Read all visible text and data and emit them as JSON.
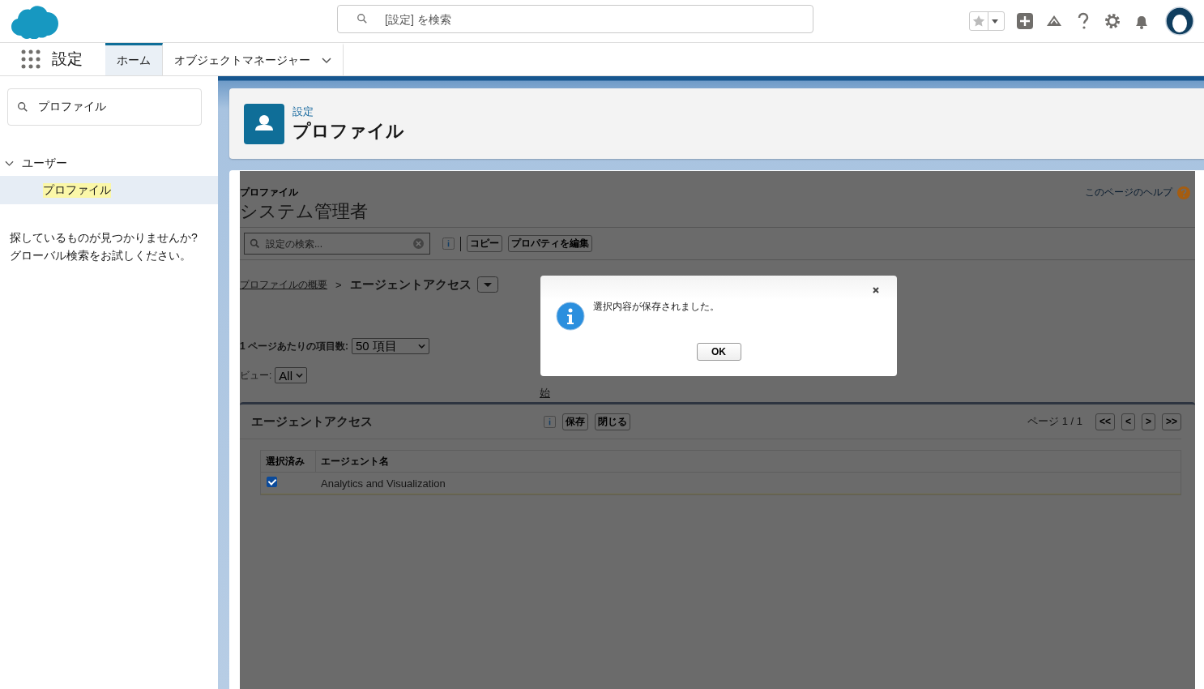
{
  "header": {
    "search": {
      "placeholder": "[設定] を検索"
    }
  },
  "nav": {
    "app_name": "設定",
    "tabs": [
      {
        "label": "ホーム",
        "selected": true,
        "has_menu": false
      },
      {
        "label": "オブジェクトマネージャー",
        "selected": false,
        "has_menu": true
      }
    ]
  },
  "sidebar": {
    "search": {
      "value": "プロファイル"
    },
    "tree": [
      {
        "label": "ユーザー",
        "expanded": true,
        "children": [
          {
            "label": "プロファイル",
            "selected": true
          }
        ]
      }
    ],
    "help_text": [
      "探しているものが見つかりませんか?",
      "グローバル検索をお試しください。"
    ]
  },
  "page_header": {
    "breadcrumb": "設定",
    "title": "プロファイル"
  },
  "content": {
    "object_type": "プロファイル",
    "title": "システム管理者",
    "help_link": "このページのヘルプ",
    "setup_search": {
      "placeholder": "設定の検索..."
    },
    "toolbar_buttons": [
      "コピー",
      "プロパティを編集"
    ],
    "breadcrumb": {
      "link": "プロファイルの概要",
      "separator": ">",
      "current": "エージェントアクセス"
    },
    "per_page": {
      "label": "1 ページあたりの項目数:",
      "value": "50 項目"
    },
    "view": {
      "label": "ビュー:",
      "value": "All"
    },
    "partial_text": "始",
    "section": {
      "title": "エージェントアクセス",
      "buttons": [
        "保存",
        "閉じる"
      ],
      "page_info": "ページ 1 / 1",
      "pager": [
        "<<",
        "<",
        ">",
        ">>"
      ],
      "columns": [
        "選択済み",
        "エージェント名"
      ],
      "rows": [
        {
          "checked": true,
          "name": "Analytics and Visualization"
        }
      ]
    }
  },
  "dialog": {
    "message": "選択内容が保存されました。",
    "ok": "OK"
  }
}
